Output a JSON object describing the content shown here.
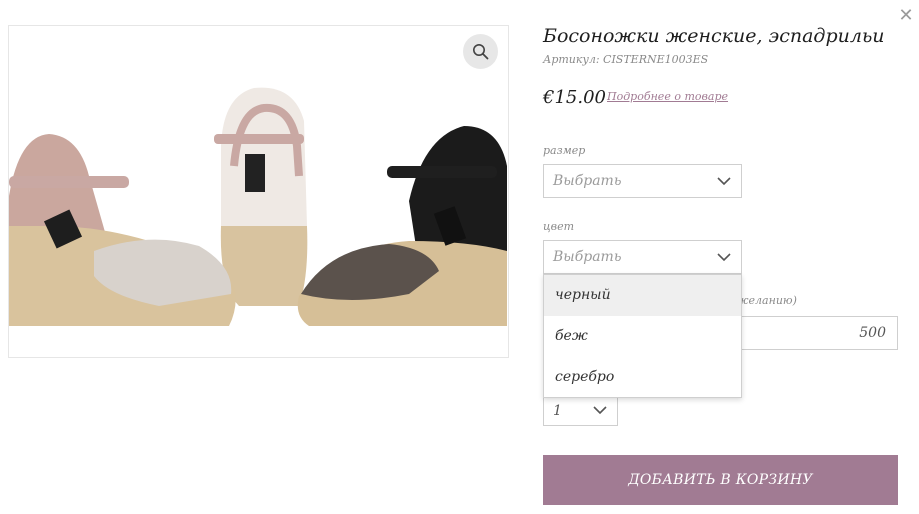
{
  "modal": {
    "close_icon": "close-icon",
    "close_glyph": "✕"
  },
  "gallery": {
    "image_alt": "product-photo-espadrille-sandals",
    "zoom_icon": "magnifier-icon"
  },
  "product": {
    "title": "Босоножки женские, эспадрильи",
    "sku": "Артикул: CISTERNE1003ES",
    "price": "€15.00",
    "details_link": "Подробнее о товаре"
  },
  "options": {
    "size_label": "размер",
    "size_value": "Выбрать",
    "color_label": "цвет",
    "color_value": "Выбрать",
    "color_options": [
      "черный",
      "беж",
      "серебро"
    ],
    "hidden_label_fragment": "желанию)",
    "amount_value": "500",
    "quantity_value": "1"
  },
  "actions": {
    "add_to_cart": "ДОБАВИТЬ В КОРЗИНУ"
  },
  "colors": {
    "accent": "#a17b93",
    "border": "#cfcfcf",
    "muted_text": "#8a8a8a"
  }
}
